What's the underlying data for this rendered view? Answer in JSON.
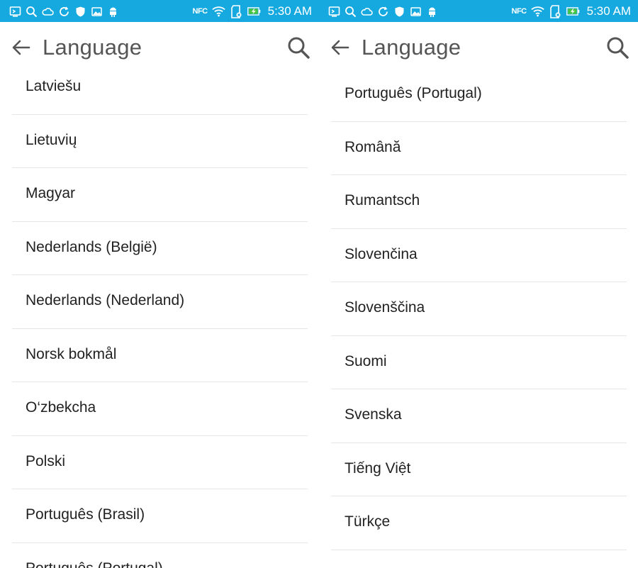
{
  "status_bar": {
    "time": "5:30 AM",
    "nfc": "NFC",
    "icons": [
      "screen-icon",
      "search-notification-icon",
      "cloud-icon",
      "sync-icon",
      "shield-icon",
      "gallery-icon",
      "android-icon",
      "nfc-icon",
      "wifi-icon",
      "sd-card-icon",
      "battery-charging-icon"
    ],
    "color": "#15a9e0"
  },
  "left": {
    "toolbar": {
      "title": "Language",
      "back_icon": "arrow-left-icon",
      "search_icon": "search-icon"
    },
    "items": [
      {
        "label": "Latviešu"
      },
      {
        "label": "Lietuvių"
      },
      {
        "label": "Magyar"
      },
      {
        "label": "Nederlands (België)"
      },
      {
        "label": "Nederlands (Nederland)"
      },
      {
        "label": "Norsk bokmål"
      },
      {
        "label": "O‘zbekcha"
      },
      {
        "label": "Polski"
      },
      {
        "label": "Português (Brasil)"
      },
      {
        "label": "Português (Portugal)"
      }
    ]
  },
  "right": {
    "toolbar": {
      "title": "Language",
      "back_icon": "arrow-left-icon",
      "search_icon": "search-icon"
    },
    "items": [
      {
        "label": "Português (Portugal)"
      },
      {
        "label": "Română"
      },
      {
        "label": "Rumantsch"
      },
      {
        "label": "Slovenčina"
      },
      {
        "label": "Slovenščina"
      },
      {
        "label": "Suomi"
      },
      {
        "label": "Svenska"
      },
      {
        "label": "Tiếng Việt"
      },
      {
        "label": "Türkçe"
      }
    ]
  }
}
